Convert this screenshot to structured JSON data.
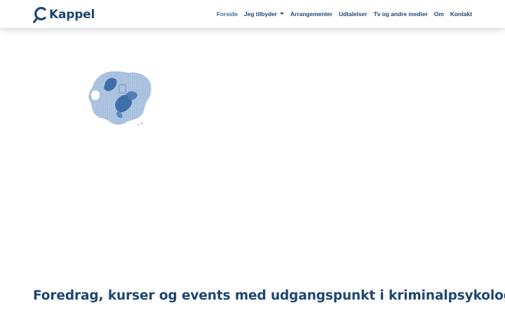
{
  "brand": {
    "name": "Kappel",
    "color": "#1f4670"
  },
  "nav": {
    "items": [
      {
        "label": "Forside",
        "active": true
      },
      {
        "label": "Jeg tilbyder",
        "dropdown": true
      },
      {
        "label": "Arrangementer"
      },
      {
        "label": "Udtalelser"
      },
      {
        "label": "Tv og andre medier"
      },
      {
        "label": "Om"
      },
      {
        "label": "Kontakt"
      }
    ],
    "active_color": "#3a6d9a"
  },
  "hero": {
    "image_icon": "broken-image-icon",
    "headline": "Foredrag, kurser og events med udgangspunkt i kriminalpsykologi"
  }
}
